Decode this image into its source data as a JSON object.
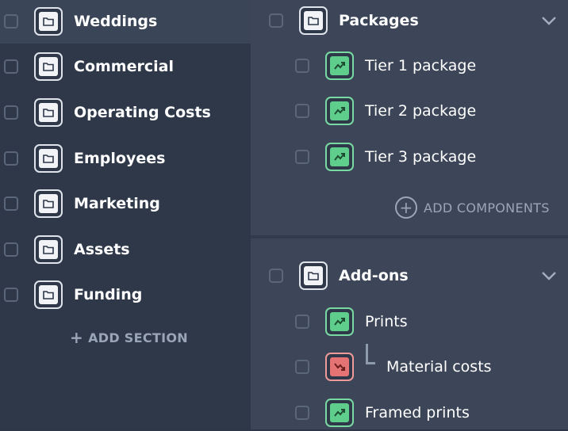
{
  "left": {
    "sections": [
      {
        "label": "Weddings",
        "active": true
      },
      {
        "label": "Commercial"
      },
      {
        "label": "Operating Costs"
      },
      {
        "label": "Employees"
      },
      {
        "label": "Marketing"
      },
      {
        "label": "Assets"
      },
      {
        "label": "Funding"
      }
    ],
    "add_section_label": "ADD SECTION"
  },
  "right": {
    "groups": [
      {
        "title": "Packages",
        "items": [
          {
            "label": "Tier 1 package",
            "kind": "revenue"
          },
          {
            "label": "Tier 2 package",
            "kind": "revenue"
          },
          {
            "label": "Tier 3 package",
            "kind": "revenue"
          }
        ],
        "add_components_label": "ADD COMPONENTS"
      },
      {
        "title": "Add-ons",
        "items": [
          {
            "label": "Prints",
            "kind": "revenue"
          },
          {
            "label": "Material costs",
            "kind": "cost",
            "nested": true
          },
          {
            "label": "Framed prints",
            "kind": "revenue"
          }
        ]
      }
    ]
  },
  "icons": {
    "folder": "folder-icon",
    "revenue": "trend-up-icon",
    "cost": "trend-down-icon",
    "chevron": "chevron-down-icon",
    "plus": "plus-icon"
  },
  "colors": {
    "revenue": "#5fce8c",
    "cost": "#e57373",
    "sidebar_bg": "#2e3849",
    "panel_bg": "#3d4658"
  }
}
